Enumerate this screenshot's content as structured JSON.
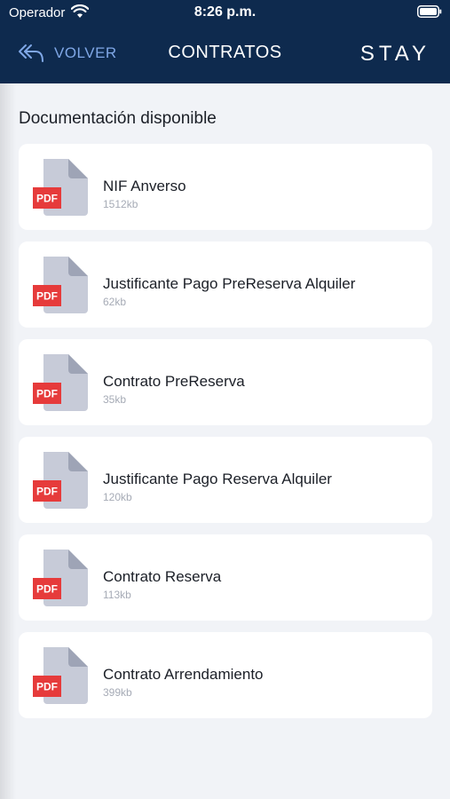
{
  "status_bar": {
    "carrier": "Operador",
    "time": "8:26 p.m.",
    "wifi_icon": "wifi-icon",
    "battery_icon": "battery-icon"
  },
  "nav": {
    "back_icon": "double-arrow-back-icon",
    "back_label": "VOLVER",
    "title": "CONTRATOS",
    "logo": "STAY"
  },
  "colors": {
    "header_bg": "#0e2a4e",
    "back_accent": "#7fa7e6",
    "page_bg": "#f1f3f7",
    "pdf_red": "#e63b3b",
    "file_gray": "#c7cbd8"
  },
  "section_title": "Documentación disponible",
  "documents": [
    {
      "name": "NIF Anverso",
      "size": "1512kb",
      "badge": "PDF"
    },
    {
      "name": "Justificante Pago PreReserva Alquiler",
      "size": "62kb",
      "badge": "PDF"
    },
    {
      "name": "Contrato PreReserva",
      "size": "35kb",
      "badge": "PDF"
    },
    {
      "name": "Justificante Pago Reserva Alquiler",
      "size": "120kb",
      "badge": "PDF"
    },
    {
      "name": "Contrato Reserva",
      "size": "113kb",
      "badge": "PDF"
    },
    {
      "name": "Contrato Arrendamiento",
      "size": "399kb",
      "badge": "PDF"
    }
  ]
}
